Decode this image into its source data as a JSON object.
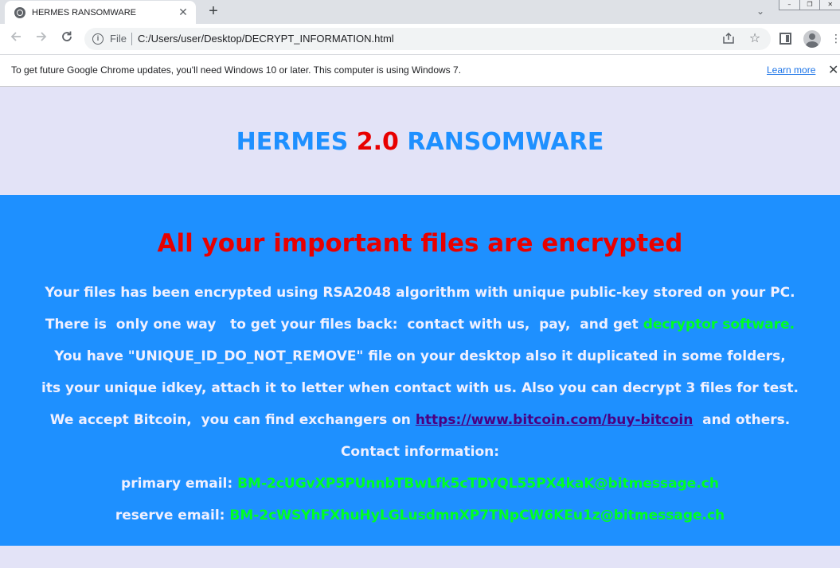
{
  "browser": {
    "tab_title": "HERMES RANSOMWARE",
    "tab_close": "✕",
    "new_tab": "+",
    "tab_search": "⌄",
    "window_buttons": [
      "–",
      "❐",
      "✕"
    ],
    "omnibox": {
      "scheme_label": "File",
      "url": "C:/Users/user/Desktop/DECRYPT_INFORMATION.html"
    },
    "infobar": {
      "message": "To get future Google Chrome updates, you'll need Windows 10 or later. This computer is using Windows 7.",
      "learn_more": "Learn more",
      "close": "✕"
    }
  },
  "page": {
    "title_part1": "HERMES",
    "title_version": "2.0",
    "title_part2": "RANSOMWARE",
    "headline": "All your important files are encrypted",
    "line1": "Your files has been encrypted using RSA2048 algorithm with unique public-key stored on your PC.",
    "line2_prefix": "There is  only one way   to get your files back:  contact with us,  pay,  and get ",
    "line2_highlight": "decryptor software.",
    "line3": "You have \"UNIQUE_ID_DO_NOT_REMOVE\" file on your desktop also it duplicated in some folders,",
    "line4": "its your unique idkey, attach it to letter when contact with us. Also you can decrypt 3 files for test.",
    "line5_prefix": "We accept Bitcoin,  you can find exchangers on ",
    "line5_link": "https://www.bitcoin.com/buy-bitcoin",
    "line5_suffix": "  and others.",
    "contact_heading": "Contact information:",
    "primary_label": "primary email: ",
    "primary_email": "BM-2cUGvXP5PUnnbTBwLfk5cTDYQL55PX4kaK@bitmessage.ch",
    "reserve_label": "reserve email: ",
    "reserve_email": "BM-2cWSYhFXhuHyLGLusdmnXP7TNpCW6KEu1z@bitmessage.ch"
  },
  "colors": {
    "title_blue": "#1e90ff",
    "version_red": "#e80000",
    "panel_blue": "#1e90ff",
    "highlight_green": "#00ff22",
    "background_lavender": "#e3e3f7"
  }
}
